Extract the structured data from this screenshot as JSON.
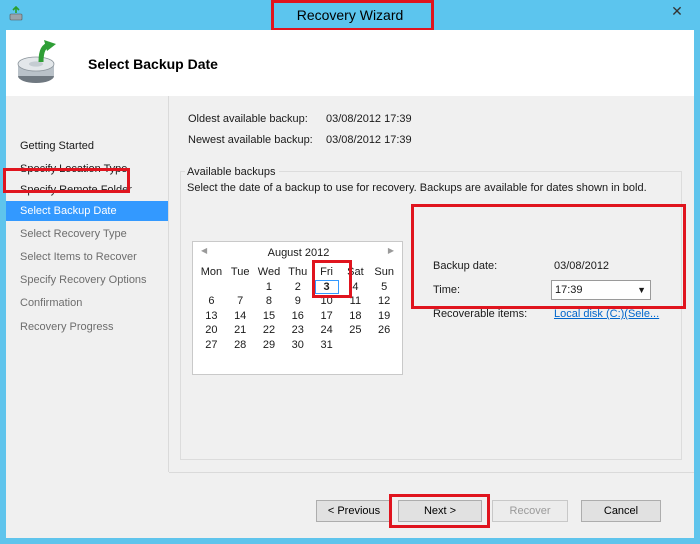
{
  "window": {
    "title": "Recovery Wizard",
    "close_glyph": "✕"
  },
  "header": {
    "title": "Select Backup Date",
    "icon": "backup-drive-icon"
  },
  "sidebar": {
    "items": [
      {
        "label": "Getting Started",
        "state": "normal"
      },
      {
        "label": "Specify Location Type",
        "state": "normal"
      },
      {
        "label": "Specify Remote Folder",
        "state": "normal"
      },
      {
        "label": "Select Backup Date",
        "state": "active"
      },
      {
        "label": "Select Recovery Type",
        "state": "disabled"
      },
      {
        "label": "Select Items to Recover",
        "state": "disabled"
      },
      {
        "label": "Specify Recovery Options",
        "state": "disabled"
      },
      {
        "label": "Confirmation",
        "state": "disabled"
      },
      {
        "label": "Recovery Progress",
        "state": "disabled"
      }
    ]
  },
  "summary": {
    "oldest_label": "Oldest available backup:",
    "oldest_value": "03/08/2012 17:39",
    "newest_label": "Newest available backup:",
    "newest_value": "03/08/2012 17:39"
  },
  "available": {
    "title": "Available backups",
    "description": "Select the date of a backup to use for recovery. Backups are available for dates shown in bold."
  },
  "calendar": {
    "prev_glyph": "◀",
    "next_glyph": "▶",
    "month": "August 2012",
    "day_headers": [
      "Mon",
      "Tue",
      "Wed",
      "Thu",
      "Fri",
      "Sat",
      "Sun"
    ],
    "weeks": [
      [
        "",
        "",
        "1",
        "2",
        "3",
        "4",
        "5"
      ],
      [
        "6",
        "7",
        "8",
        "9",
        "10",
        "11",
        "12"
      ],
      [
        "13",
        "14",
        "15",
        "16",
        "17",
        "18",
        "19"
      ],
      [
        "20",
        "21",
        "22",
        "23",
        "24",
        "25",
        "26"
      ],
      [
        "27",
        "28",
        "29",
        "30",
        "31",
        "",
        ""
      ]
    ],
    "selected_day": "3"
  },
  "details": {
    "date_label": "Backup date:",
    "date_value": "03/08/2012",
    "time_label": "Time:",
    "time_value": "17:39",
    "items_label": "Recoverable items:",
    "items_link": "Local disk (C:)(Sele..."
  },
  "buttons": {
    "previous": "< Previous",
    "next": "Next >",
    "recover": "Recover",
    "cancel": "Cancel"
  },
  "colors": {
    "highlight": "#e0141e",
    "selection": "#3399ff",
    "titlebar": "#5cc5ee"
  }
}
